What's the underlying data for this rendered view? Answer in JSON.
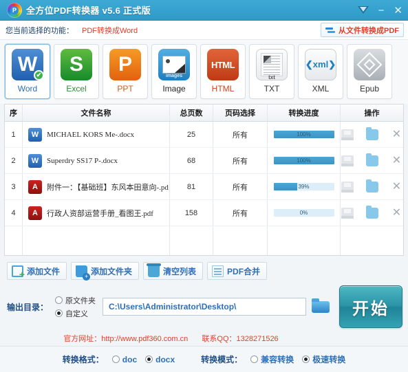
{
  "titlebar": {
    "title": "全方位PDF转换器 v5.6 正式版",
    "logo_letter": "P",
    "menu_icon": "chevron-down-icon",
    "minimize": "−",
    "close": "✕"
  },
  "funcbar": {
    "label": "您当前选择的功能：",
    "value": "PDF转换成Word",
    "to_pdf_button": "从文件转换成PDF"
  },
  "formats": [
    {
      "key": "word",
      "letter": "W",
      "caption": "Word",
      "selected": true,
      "check": "✔"
    },
    {
      "key": "excel",
      "letter": "S",
      "caption": "Excel",
      "selected": false
    },
    {
      "key": "ppt",
      "letter": "P",
      "caption": "PPT",
      "selected": false
    },
    {
      "key": "image",
      "letter": "images",
      "caption": "Image",
      "selected": false
    },
    {
      "key": "html",
      "letter": "HTML",
      "caption": "HTML",
      "selected": false
    },
    {
      "key": "txt",
      "letter": "txt",
      "caption": "TXT",
      "selected": false
    },
    {
      "key": "xml",
      "letter": "❮xml❯",
      "caption": "XML",
      "selected": false
    },
    {
      "key": "epub",
      "letter": "",
      "caption": "Epub",
      "selected": false
    }
  ],
  "table": {
    "headers": {
      "index": "序",
      "name": "文件名称",
      "pages": "总页数",
      "range": "页码选择",
      "progress": "转换进度",
      "ops": "操作"
    },
    "rows": [
      {
        "index": "1",
        "icon": "word-file-icon",
        "name": "MICHAEL KORS Me-.docx",
        "pages": "25",
        "range": "所有",
        "progress": 100,
        "progress_label": "100%"
      },
      {
        "index": "2",
        "icon": "word-file-icon",
        "name": "Superdry SS17 P-.docx",
        "pages": "68",
        "range": "所有",
        "progress": 100,
        "progress_label": "100%"
      },
      {
        "index": "3",
        "icon": "pdf-file-icon",
        "name": "附件一：【基础班】东风本田意向-.pd",
        "pages": "81",
        "range": "所有",
        "progress": 39,
        "progress_label": "39%"
      },
      {
        "index": "4",
        "icon": "pdf-file-icon",
        "name": "行政人资部运营手册_看图王.pdf",
        "pages": "158",
        "range": "所有",
        "progress": 0,
        "progress_label": "0%"
      }
    ],
    "op_icons": {
      "save": "save-icon",
      "folder": "folder-icon",
      "remove": "✕"
    }
  },
  "actions": [
    {
      "key": "add-file",
      "label": "添加文件",
      "icon": "add-file-icon"
    },
    {
      "key": "add-folder",
      "label": "添加文件夹",
      "icon": "add-folder-icon"
    },
    {
      "key": "clear-list",
      "label": "清空列表",
      "icon": "trash-icon"
    },
    {
      "key": "pdf-merge",
      "label": "PDF合并",
      "icon": "merge-icon"
    }
  ],
  "output": {
    "label": "输出目录：",
    "options": [
      {
        "key": "source-folder",
        "label": "原文件夹",
        "selected": false
      },
      {
        "key": "custom",
        "label": "自定义",
        "selected": true
      }
    ],
    "path_value": "C:\\Users\\Administrator\\Desktop\\",
    "path_placeholder": "C:\\Users\\Administrator\\Desktop\\",
    "browse_icon": "folder-browse-icon",
    "start_button": "开始"
  },
  "links": {
    "site_label": "官方网址：http://www.pdf360.com.cn",
    "qq_label": "联系QQ：1328271526"
  },
  "bottom": {
    "format_label": "转换格式：",
    "format_options": [
      {
        "key": "doc",
        "label": "doc",
        "selected": false
      },
      {
        "key": "docx",
        "label": "docx",
        "selected": true
      }
    ],
    "mode_label": "转换模式：",
    "mode_options": [
      {
        "key": "compat",
        "label": "兼容转换",
        "selected": false
      },
      {
        "key": "fast",
        "label": "极速转换",
        "selected": true
      }
    ]
  },
  "colors": {
    "titlebar": "#3fa9d4",
    "accent_red": "#e2402a",
    "accent_blue": "#2f6fb5",
    "progress_fill": "#4ba7d4",
    "start_button": "#2a93a6"
  }
}
